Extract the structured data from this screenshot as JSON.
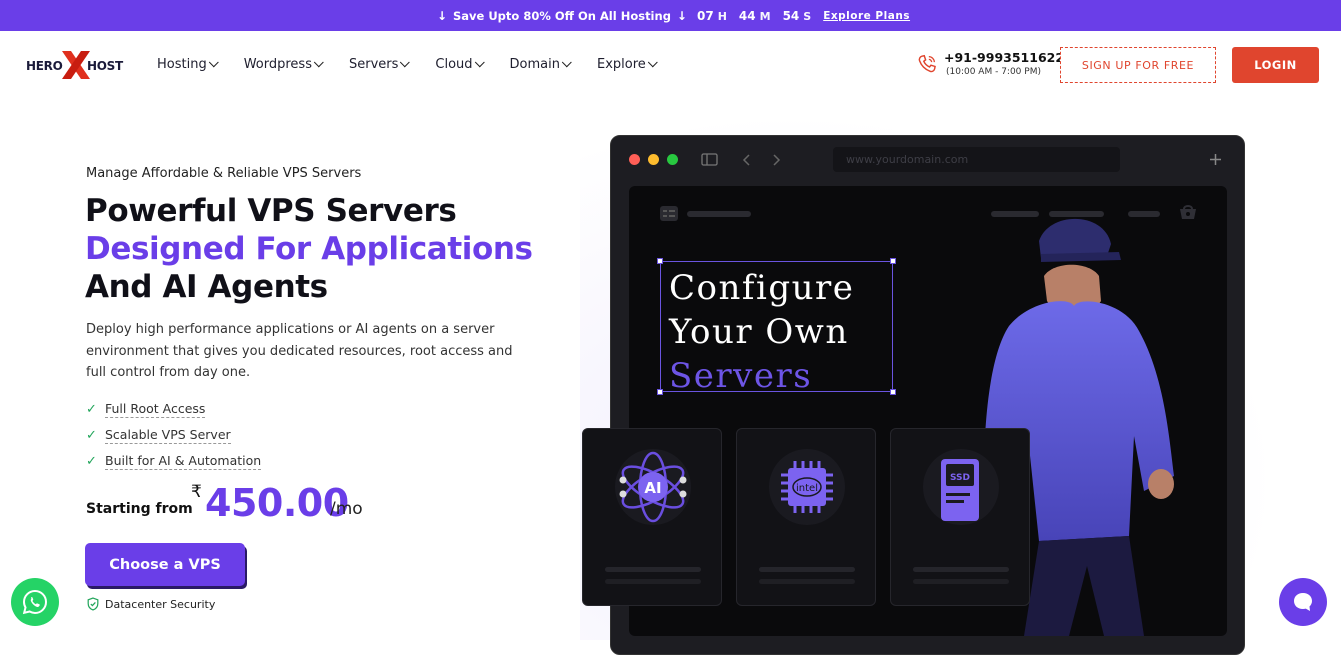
{
  "promo": {
    "text": "Save Upto 80% Off On All Hosting",
    "hours": "07",
    "hours_unit": "H",
    "minutes": "44",
    "minutes_unit": "M",
    "seconds": "54",
    "seconds_unit": "S",
    "link": "Explore Plans"
  },
  "logo": {
    "left": "HERO",
    "right": "HOST"
  },
  "nav": {
    "items": [
      {
        "label": "Hosting"
      },
      {
        "label": "Wordpress"
      },
      {
        "label": "Servers"
      },
      {
        "label": "Cloud"
      },
      {
        "label": "Domain"
      },
      {
        "label": "Explore"
      }
    ]
  },
  "contact": {
    "phone": "+91-9993511622",
    "hours": "(10:00 AM - 7:00 PM)"
  },
  "header": {
    "signup": "SIGN UP FOR FREE",
    "login": "LOGIN"
  },
  "hero": {
    "eyebrow": "Manage Affordable & Reliable VPS Servers",
    "title_line1": "Powerful VPS Servers",
    "title_line2": "Designed For Applications",
    "title_line3": "And AI Agents",
    "description": "Deploy high performance applications or AI agents on a server environment that gives you dedicated resources, root access and full control from day one.",
    "features": [
      {
        "label": "Full Root Access"
      },
      {
        "label": "Scalable VPS Server"
      },
      {
        "label": "Built for AI & Automation"
      }
    ],
    "price_label": "Starting from",
    "currency": "₹",
    "price": "450.00",
    "per": "/mo",
    "cta": "Choose a VPS",
    "security": "Datacenter Security"
  },
  "mockup": {
    "url": "www.yourdomain.com",
    "headline_1": "Configure",
    "headline_2": "Your Own",
    "headline_3": "Servers",
    "card_labels": [
      "AI",
      "intel",
      "SSD"
    ]
  },
  "colors": {
    "brand_purple": "#6a3ee8",
    "accent_red": "#e0452e",
    "whatsapp_green": "#25d366"
  }
}
